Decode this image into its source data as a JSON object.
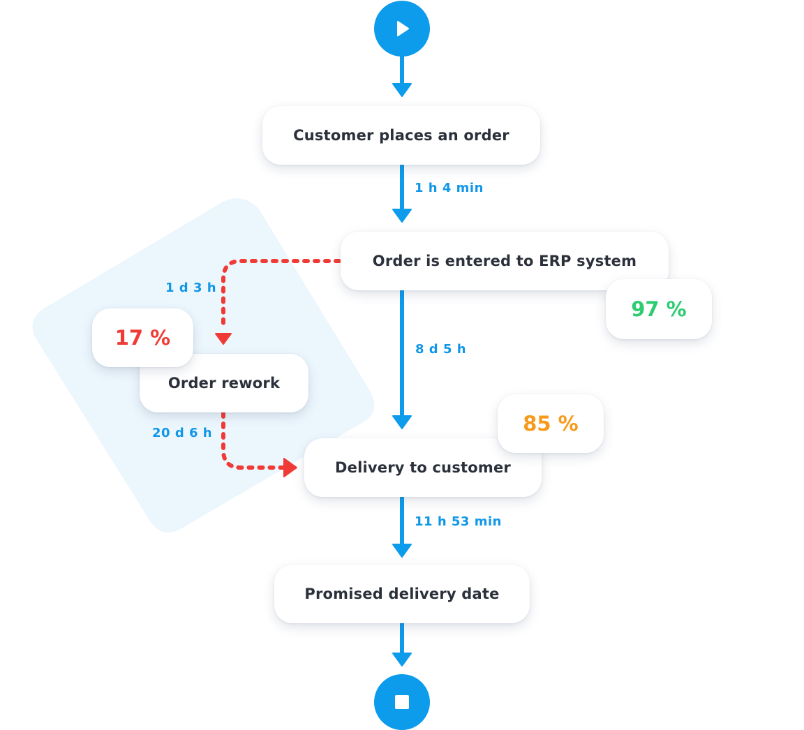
{
  "colors": {
    "flow": "#0d9bec",
    "rework": "#f03a35",
    "duration_text": "#1197e8",
    "node_text": "#2b303b",
    "background_shape": "#ecf6fd",
    "pct_good": "#2ecc71",
    "pct_warn": "#f79a1b",
    "pct_bad": "#f03a35"
  },
  "start": {
    "icon": "play-icon",
    "label": "Start"
  },
  "end": {
    "icon": "stop-icon",
    "label": "End"
  },
  "nodes": {
    "customer_order": "Customer places an order",
    "erp_entry": "Order is entered to ERP system",
    "rework": "Order rework",
    "delivery": "Delivery to customer",
    "promised_date": "Promised delivery date"
  },
  "durations": {
    "order_to_erp": "1 h 4 min",
    "erp_to_rework": "1 d 3 h",
    "erp_to_delivery": "8 d 5 h",
    "rework_to_delivery": "20 d 6 h",
    "delivery_to_promised": "11 h 53 min"
  },
  "percentages": {
    "erp_entry": "97 %",
    "rework": "17 %",
    "delivery": "85 %"
  }
}
